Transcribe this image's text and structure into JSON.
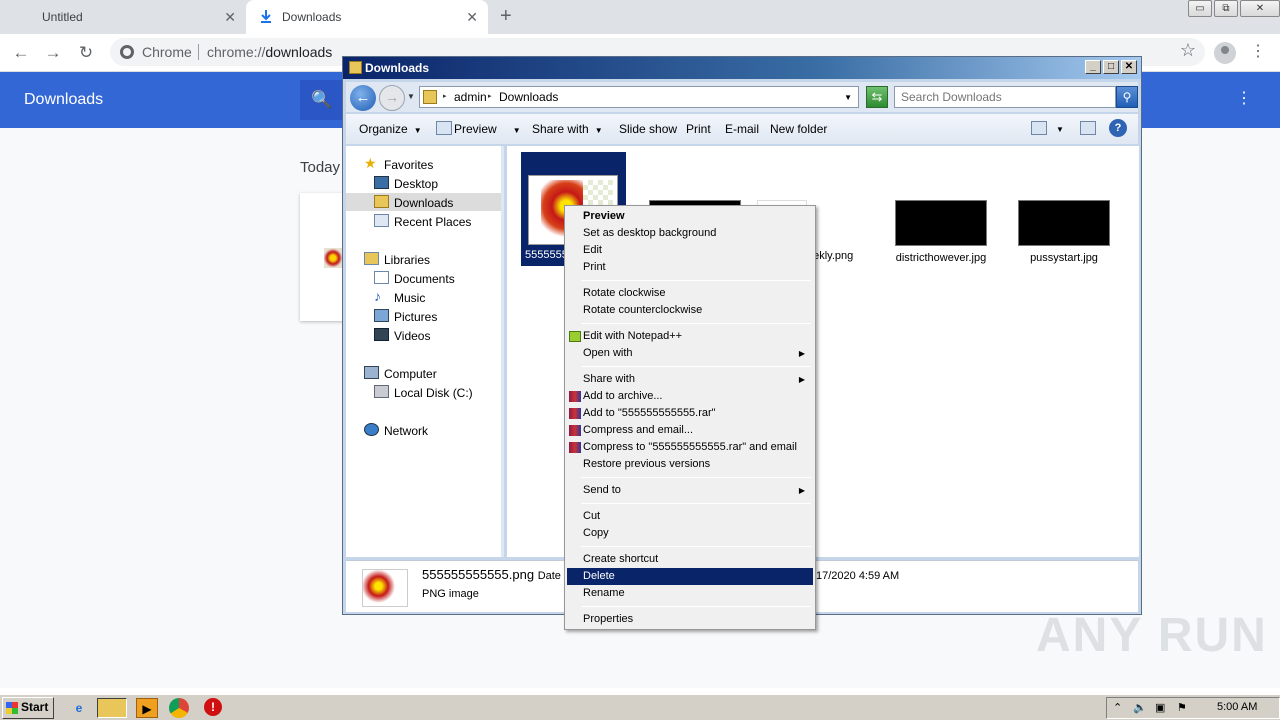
{
  "browser": {
    "tabs": [
      {
        "title": "Untitled",
        "close": "✕"
      },
      {
        "title": "Downloads",
        "close": "✕"
      }
    ],
    "new_tab": "+",
    "win_buttons": [
      "▭",
      "⧉",
      "✕"
    ],
    "nav": {
      "back": "←",
      "forward": "→",
      "reload": "↻"
    },
    "omnibox": {
      "label": "Chrome",
      "url_scheme": "chrome://",
      "url_host": "downloads"
    },
    "star": "☆",
    "menu": "⋮"
  },
  "downloads_page": {
    "title": "Downloads",
    "search_icon": "🔍",
    "menu": "⋮",
    "section": "Today"
  },
  "explorer": {
    "title": "Downloads",
    "title_buttons": [
      "_",
      "□",
      "✕"
    ],
    "breadcrumb": [
      "admin",
      "Downloads"
    ],
    "search_placeholder": "Search Downloads",
    "commands": [
      {
        "label": "Organize",
        "dropdown": true
      },
      {
        "label": "Preview",
        "dropdown": true
      },
      {
        "label": "Share with",
        "dropdown": true
      },
      {
        "label": "Slide show",
        "dropdown": false
      },
      {
        "label": "Print",
        "dropdown": false
      },
      {
        "label": "E-mail",
        "dropdown": false
      },
      {
        "label": "New folder",
        "dropdown": false
      }
    ],
    "help": "?",
    "nav_pane": [
      {
        "label": "Favorites",
        "icon": "star-icon"
      },
      {
        "label": "Desktop",
        "icon": "desktop-icon"
      },
      {
        "label": "Downloads",
        "icon": "downloads-folder-icon",
        "selected": true
      },
      {
        "label": "Recent Places",
        "icon": "recent-places-icon"
      },
      {
        "label": "Libraries",
        "icon": "libraries-icon"
      },
      {
        "label": "Documents",
        "icon": "documents-icon"
      },
      {
        "label": "Music",
        "icon": "music-icon"
      },
      {
        "label": "Pictures",
        "icon": "pictures-icon"
      },
      {
        "label": "Videos",
        "icon": "videos-icon"
      },
      {
        "label": "Computer",
        "icon": "computer-icon"
      },
      {
        "label": "Local Disk (C:)",
        "icon": "disk-icon"
      },
      {
        "label": "Network",
        "icon": "network-icon"
      }
    ],
    "files": [
      {
        "name": "5555555"
      },
      {
        "name": "eekly.png"
      },
      {
        "name": "districthowever.jpg"
      },
      {
        "name": "pussystart.jpg"
      }
    ],
    "details": {
      "name": "555555555555.png",
      "date_label": "Date",
      "type": "PNG image",
      "date_value": "17/2020 4:59 AM"
    }
  },
  "context_menu": {
    "items": [
      {
        "label": "Preview",
        "bold": true
      },
      {
        "label": "Set as desktop background"
      },
      {
        "label": "Edit"
      },
      {
        "label": "Print"
      },
      {
        "separator": true
      },
      {
        "label": "Rotate clockwise"
      },
      {
        "label": "Rotate counterclockwise"
      },
      {
        "separator": true
      },
      {
        "label": "Edit with Notepad++",
        "icon": "notepadpp-icon"
      },
      {
        "label": "Open with",
        "submenu": true
      },
      {
        "separator": true
      },
      {
        "label": "Share with",
        "submenu": true
      },
      {
        "label": "Add to archive...",
        "icon": "winrar-icon"
      },
      {
        "label": "Add to \"555555555555.rar\"",
        "icon": "winrar-icon"
      },
      {
        "label": "Compress and email...",
        "icon": "winrar-icon"
      },
      {
        "label": "Compress to \"555555555555.rar\" and email",
        "icon": "winrar-icon"
      },
      {
        "label": "Restore previous versions"
      },
      {
        "separator": true
      },
      {
        "label": "Send to",
        "submenu": true
      },
      {
        "separator": true
      },
      {
        "label": "Cut"
      },
      {
        "label": "Copy"
      },
      {
        "separator": true
      },
      {
        "label": "Create shortcut"
      },
      {
        "label": "Delete",
        "highlighted": true
      },
      {
        "label": "Rename"
      },
      {
        "separator": true
      },
      {
        "label": "Properties"
      }
    ]
  },
  "taskbar": {
    "start": "Start",
    "clock": "5:00 AM",
    "tray_arrows": "⌃"
  },
  "watermark": "ANY RUN"
}
